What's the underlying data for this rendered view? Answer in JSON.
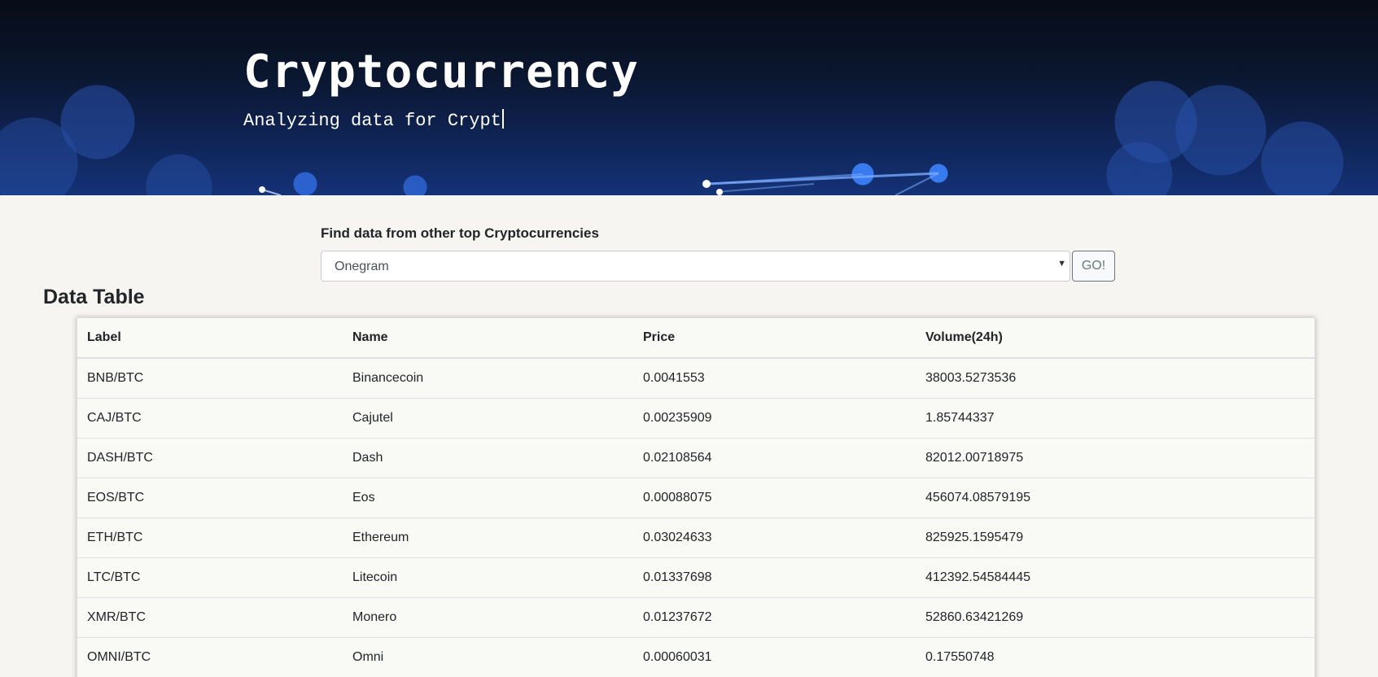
{
  "header": {
    "title": "Cryptocurrency",
    "subtitle": "Analyzing data for Crypt"
  },
  "finder": {
    "label": "Find data from other top Cryptocurrencies",
    "selected": "Onegram",
    "go_label": "GO!"
  },
  "table": {
    "title": "Data Table",
    "columns": [
      "Label",
      "Name",
      "Price",
      "Volume(24h)"
    ],
    "rows": [
      [
        "BNB/BTC",
        "Binancecoin",
        "0.0041553",
        "38003.5273536"
      ],
      [
        "CAJ/BTC",
        "Cajutel",
        "0.00235909",
        "1.85744337"
      ],
      [
        "DASH/BTC",
        "Dash",
        "0.02108564",
        "82012.00718975"
      ],
      [
        "EOS/BTC",
        "Eos",
        "0.00088075",
        "456074.08579195"
      ],
      [
        "ETH/BTC",
        "Ethereum",
        "0.03024633",
        "825925.1595479"
      ],
      [
        "LTC/BTC",
        "Litecoin",
        "0.01337698",
        "412392.54584445"
      ],
      [
        "XMR/BTC",
        "Monero",
        "0.01237672",
        "52860.63421269"
      ],
      [
        "OMNI/BTC",
        "Omni",
        "0.00060031",
        "0.17550748"
      ]
    ]
  },
  "colors": {
    "header_bg": "#0b1730",
    "page_bg": "#f6f5f1",
    "text": "#212529"
  }
}
